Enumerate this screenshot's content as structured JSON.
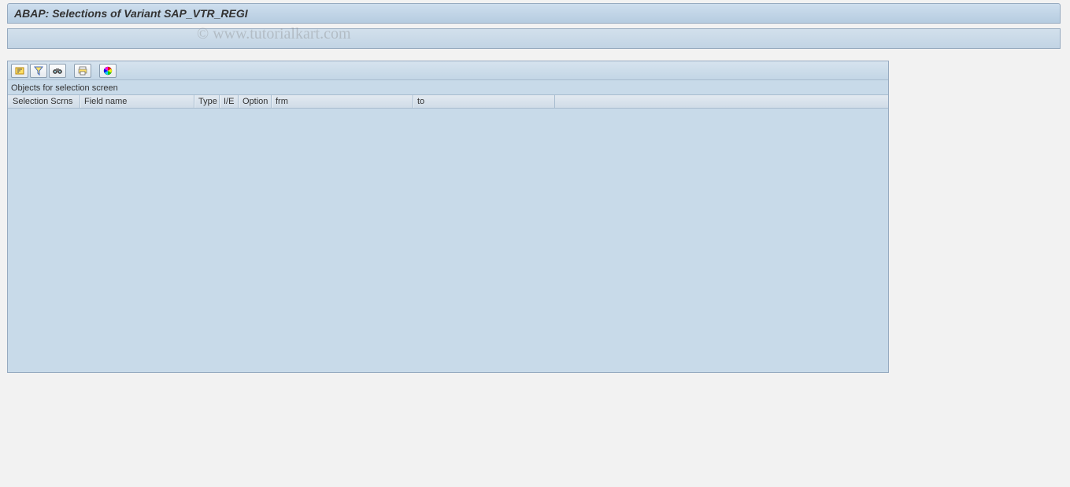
{
  "title": "ABAP: Selections of Variant SAP_VTR_REGI",
  "watermark": "© www.tutorialkart.com",
  "section_label": "Objects for selection screen",
  "columns": {
    "selection_scrns": "Selection Scrns",
    "field_name": "Field name",
    "type": "Type",
    "ie": "I/E",
    "option": "Option",
    "frm": "frm",
    "to": "to"
  },
  "toolbar": {
    "sort_asc": "sort-ascending",
    "filter": "filter",
    "find": "find",
    "print": "print",
    "color": "color-legend"
  }
}
